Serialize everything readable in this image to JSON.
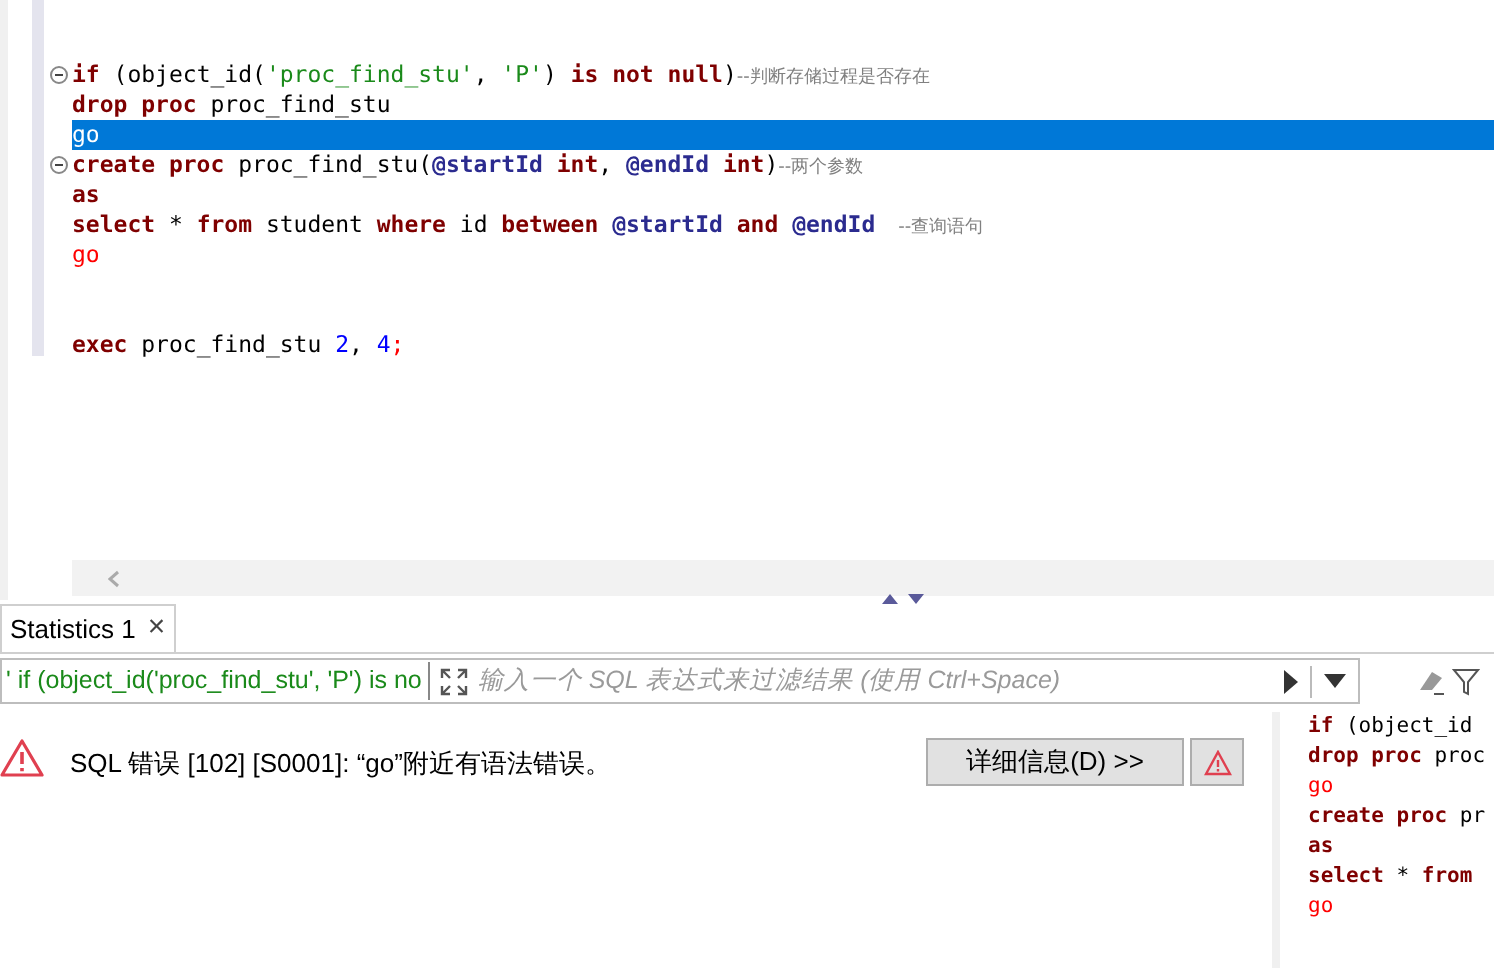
{
  "editor": {
    "lines": [
      {
        "kind": "code",
        "fold": true,
        "selected": false,
        "tokens": [
          {
            "t": "if",
            "kind": "kw"
          },
          {
            "t": " (object_id(",
            "kind": "plain"
          },
          {
            "t": "'proc_find_stu'",
            "kind": "str"
          },
          {
            "t": ", ",
            "kind": "plain"
          },
          {
            "t": "'P'",
            "kind": "str"
          },
          {
            "t": ") ",
            "kind": "plain"
          },
          {
            "t": "is not null",
            "kind": "kw"
          },
          {
            "t": ")",
            "kind": "plain"
          },
          {
            "t": "--判断存储过程是否存在",
            "kind": "comment"
          }
        ]
      },
      {
        "kind": "code",
        "fold": false,
        "selected": false,
        "tokens": [
          {
            "t": "drop proc",
            "kind": "kw"
          },
          {
            "t": " proc_find_stu",
            "kind": "plain"
          }
        ]
      },
      {
        "kind": "code",
        "fold": false,
        "selected": true,
        "tokens": [
          {
            "t": "go",
            "kind": "go"
          }
        ]
      },
      {
        "kind": "code",
        "fold": true,
        "selected": false,
        "tokens": [
          {
            "t": "create proc",
            "kind": "kw"
          },
          {
            "t": " proc_find_stu(",
            "kind": "plain"
          },
          {
            "t": "@startId",
            "kind": "var"
          },
          {
            "t": " int",
            "kind": "kw"
          },
          {
            "t": ", ",
            "kind": "plain"
          },
          {
            "t": "@endId",
            "kind": "var"
          },
          {
            "t": " int",
            "kind": "kw"
          },
          {
            "t": ")",
            "kind": "plain"
          },
          {
            "t": "--两个参数",
            "kind": "comment"
          }
        ]
      },
      {
        "kind": "code",
        "fold": false,
        "selected": false,
        "tokens": [
          {
            "t": "as",
            "kind": "kw"
          }
        ]
      },
      {
        "kind": "code",
        "fold": false,
        "selected": false,
        "tokens": [
          {
            "t": "select",
            "kind": "kw"
          },
          {
            "t": " * ",
            "kind": "plain"
          },
          {
            "t": "from",
            "kind": "kw"
          },
          {
            "t": " student ",
            "kind": "plain"
          },
          {
            "t": "where",
            "kind": "kw"
          },
          {
            "t": " id ",
            "kind": "plain"
          },
          {
            "t": "between",
            "kind": "kw"
          },
          {
            "t": " @startId",
            "kind": "var"
          },
          {
            "t": " and",
            "kind": "kw"
          },
          {
            "t": " @endId",
            "kind": "var"
          },
          {
            "t": "    --查询语句",
            "kind": "comment"
          }
        ]
      },
      {
        "kind": "code",
        "fold": false,
        "selected": false,
        "tokens": [
          {
            "t": "go",
            "kind": "go"
          }
        ]
      },
      {
        "kind": "blank"
      },
      {
        "kind": "blank"
      },
      {
        "kind": "code",
        "fold": false,
        "selected": false,
        "tokens": [
          {
            "t": "exec",
            "kind": "kw"
          },
          {
            "t": " proc_find_stu ",
            "kind": "plain"
          },
          {
            "t": "2",
            "kind": "num"
          },
          {
            "t": ", ",
            "kind": "plain"
          },
          {
            "t": "4",
            "kind": "num"
          },
          {
            "t": ";",
            "kind": "go"
          }
        ]
      }
    ]
  },
  "results_tab": {
    "label": "Statistics 1",
    "close": "×"
  },
  "filter": {
    "query": "' if (object_id('proc_find_stu', 'P') is no",
    "placeholder": "输入一个 SQL 表达式来过滤结果 (使用 Ctrl+Space)"
  },
  "error": {
    "message": "SQL 错误 [102] [S0001]: “go”附近有语法错误。",
    "details_button": "详细信息(D) >>"
  },
  "side_query": {
    "lines": [
      {
        "tokens": [
          {
            "t": "if",
            "kind": "kw"
          },
          {
            "t": " (object_id",
            "kind": "plain"
          }
        ]
      },
      {
        "tokens": [
          {
            "t": "drop proc",
            "kind": "kw"
          },
          {
            "t": " proc",
            "kind": "plain"
          }
        ]
      },
      {
        "tokens": [
          {
            "t": "go",
            "kind": "go"
          }
        ]
      },
      {
        "tokens": [
          {
            "t": "create proc",
            "kind": "kw"
          },
          {
            "t": " pr",
            "kind": "plain"
          }
        ]
      },
      {
        "tokens": [
          {
            "t": "as",
            "kind": "kw"
          }
        ]
      },
      {
        "tokens": [
          {
            "t": "select",
            "kind": "kw"
          },
          {
            "t": " * ",
            "kind": "plain"
          },
          {
            "t": "from",
            "kind": "kw"
          }
        ]
      },
      {
        "tokens": [
          {
            "t": "go",
            "kind": "go"
          }
        ]
      }
    ]
  }
}
